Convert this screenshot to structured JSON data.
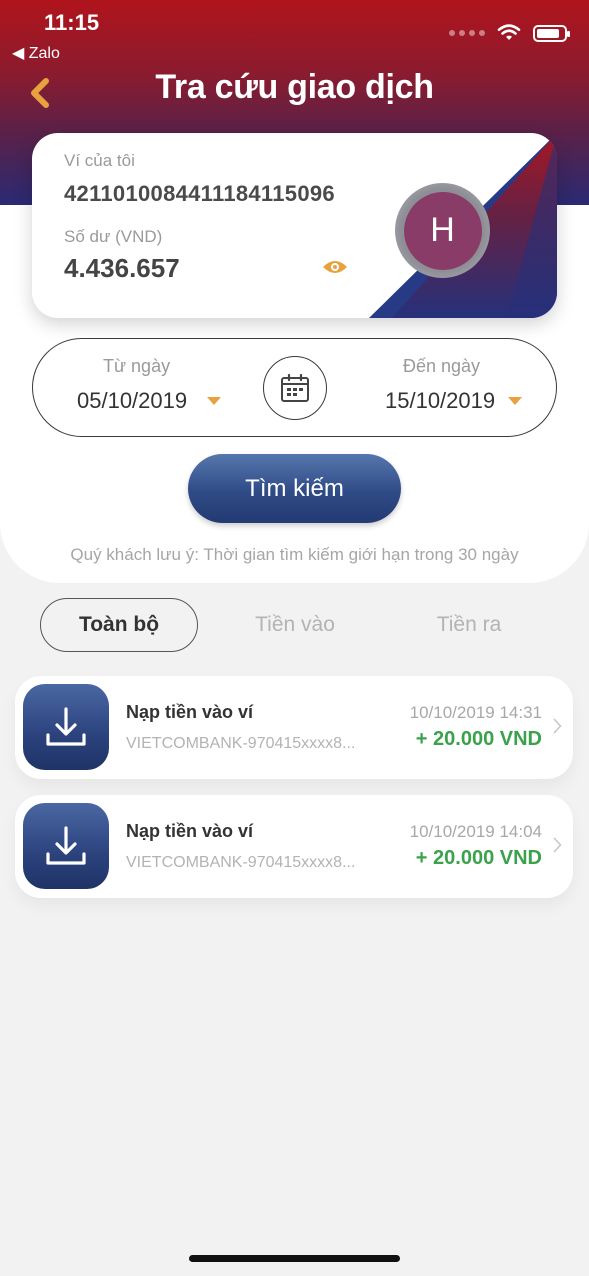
{
  "status_bar": {
    "time": "11:15",
    "back_app": "◀ Zalo"
  },
  "header": {
    "title": "Tra cứu giao dịch"
  },
  "wallet": {
    "label": "Ví của tôi",
    "number": "421101008441118411509 6",
    "balance_label": "Số dư (VND)",
    "balance": "4.436.657",
    "avatar_initial": "H"
  },
  "date_range": {
    "from_label": "Từ ngày",
    "from_value": "05/10/2019",
    "to_label": "Đến ngày",
    "to_value": "15/10/2019"
  },
  "search": {
    "button_label": "Tìm kiếm",
    "note": "Quý khách lưu ý: Thời gian tìm kiếm giới hạn trong 30 ngày"
  },
  "tabs": [
    {
      "label": "Toàn bộ",
      "active": true
    },
    {
      "label": "Tiền vào",
      "active": false
    },
    {
      "label": "Tiền ra",
      "active": false
    }
  ],
  "transactions": [
    {
      "title": "Nạp tiền vào ví",
      "source": "VIETCOMBANK-970415xxxx8...",
      "time": "10/10/2019 14:31",
      "amount": "+ 20.000 VND"
    },
    {
      "title": "Nạp tiền vào ví",
      "source": "VIETCOMBANK-970415xxxx8...",
      "time": "10/10/2019 14:04",
      "amount": "+ 20.000 VND"
    }
  ],
  "colors": {
    "accent_orange": "#e8a23d",
    "primary_blue": "#2f4b86",
    "header_red": "#b0141c",
    "amount_green": "#3aa24a"
  },
  "icons": {
    "back": "chevron-left-icon",
    "eye": "eye-icon",
    "calendar": "calendar-icon",
    "deposit": "download-icon",
    "row_arrow": "chevron-right-icon"
  }
}
